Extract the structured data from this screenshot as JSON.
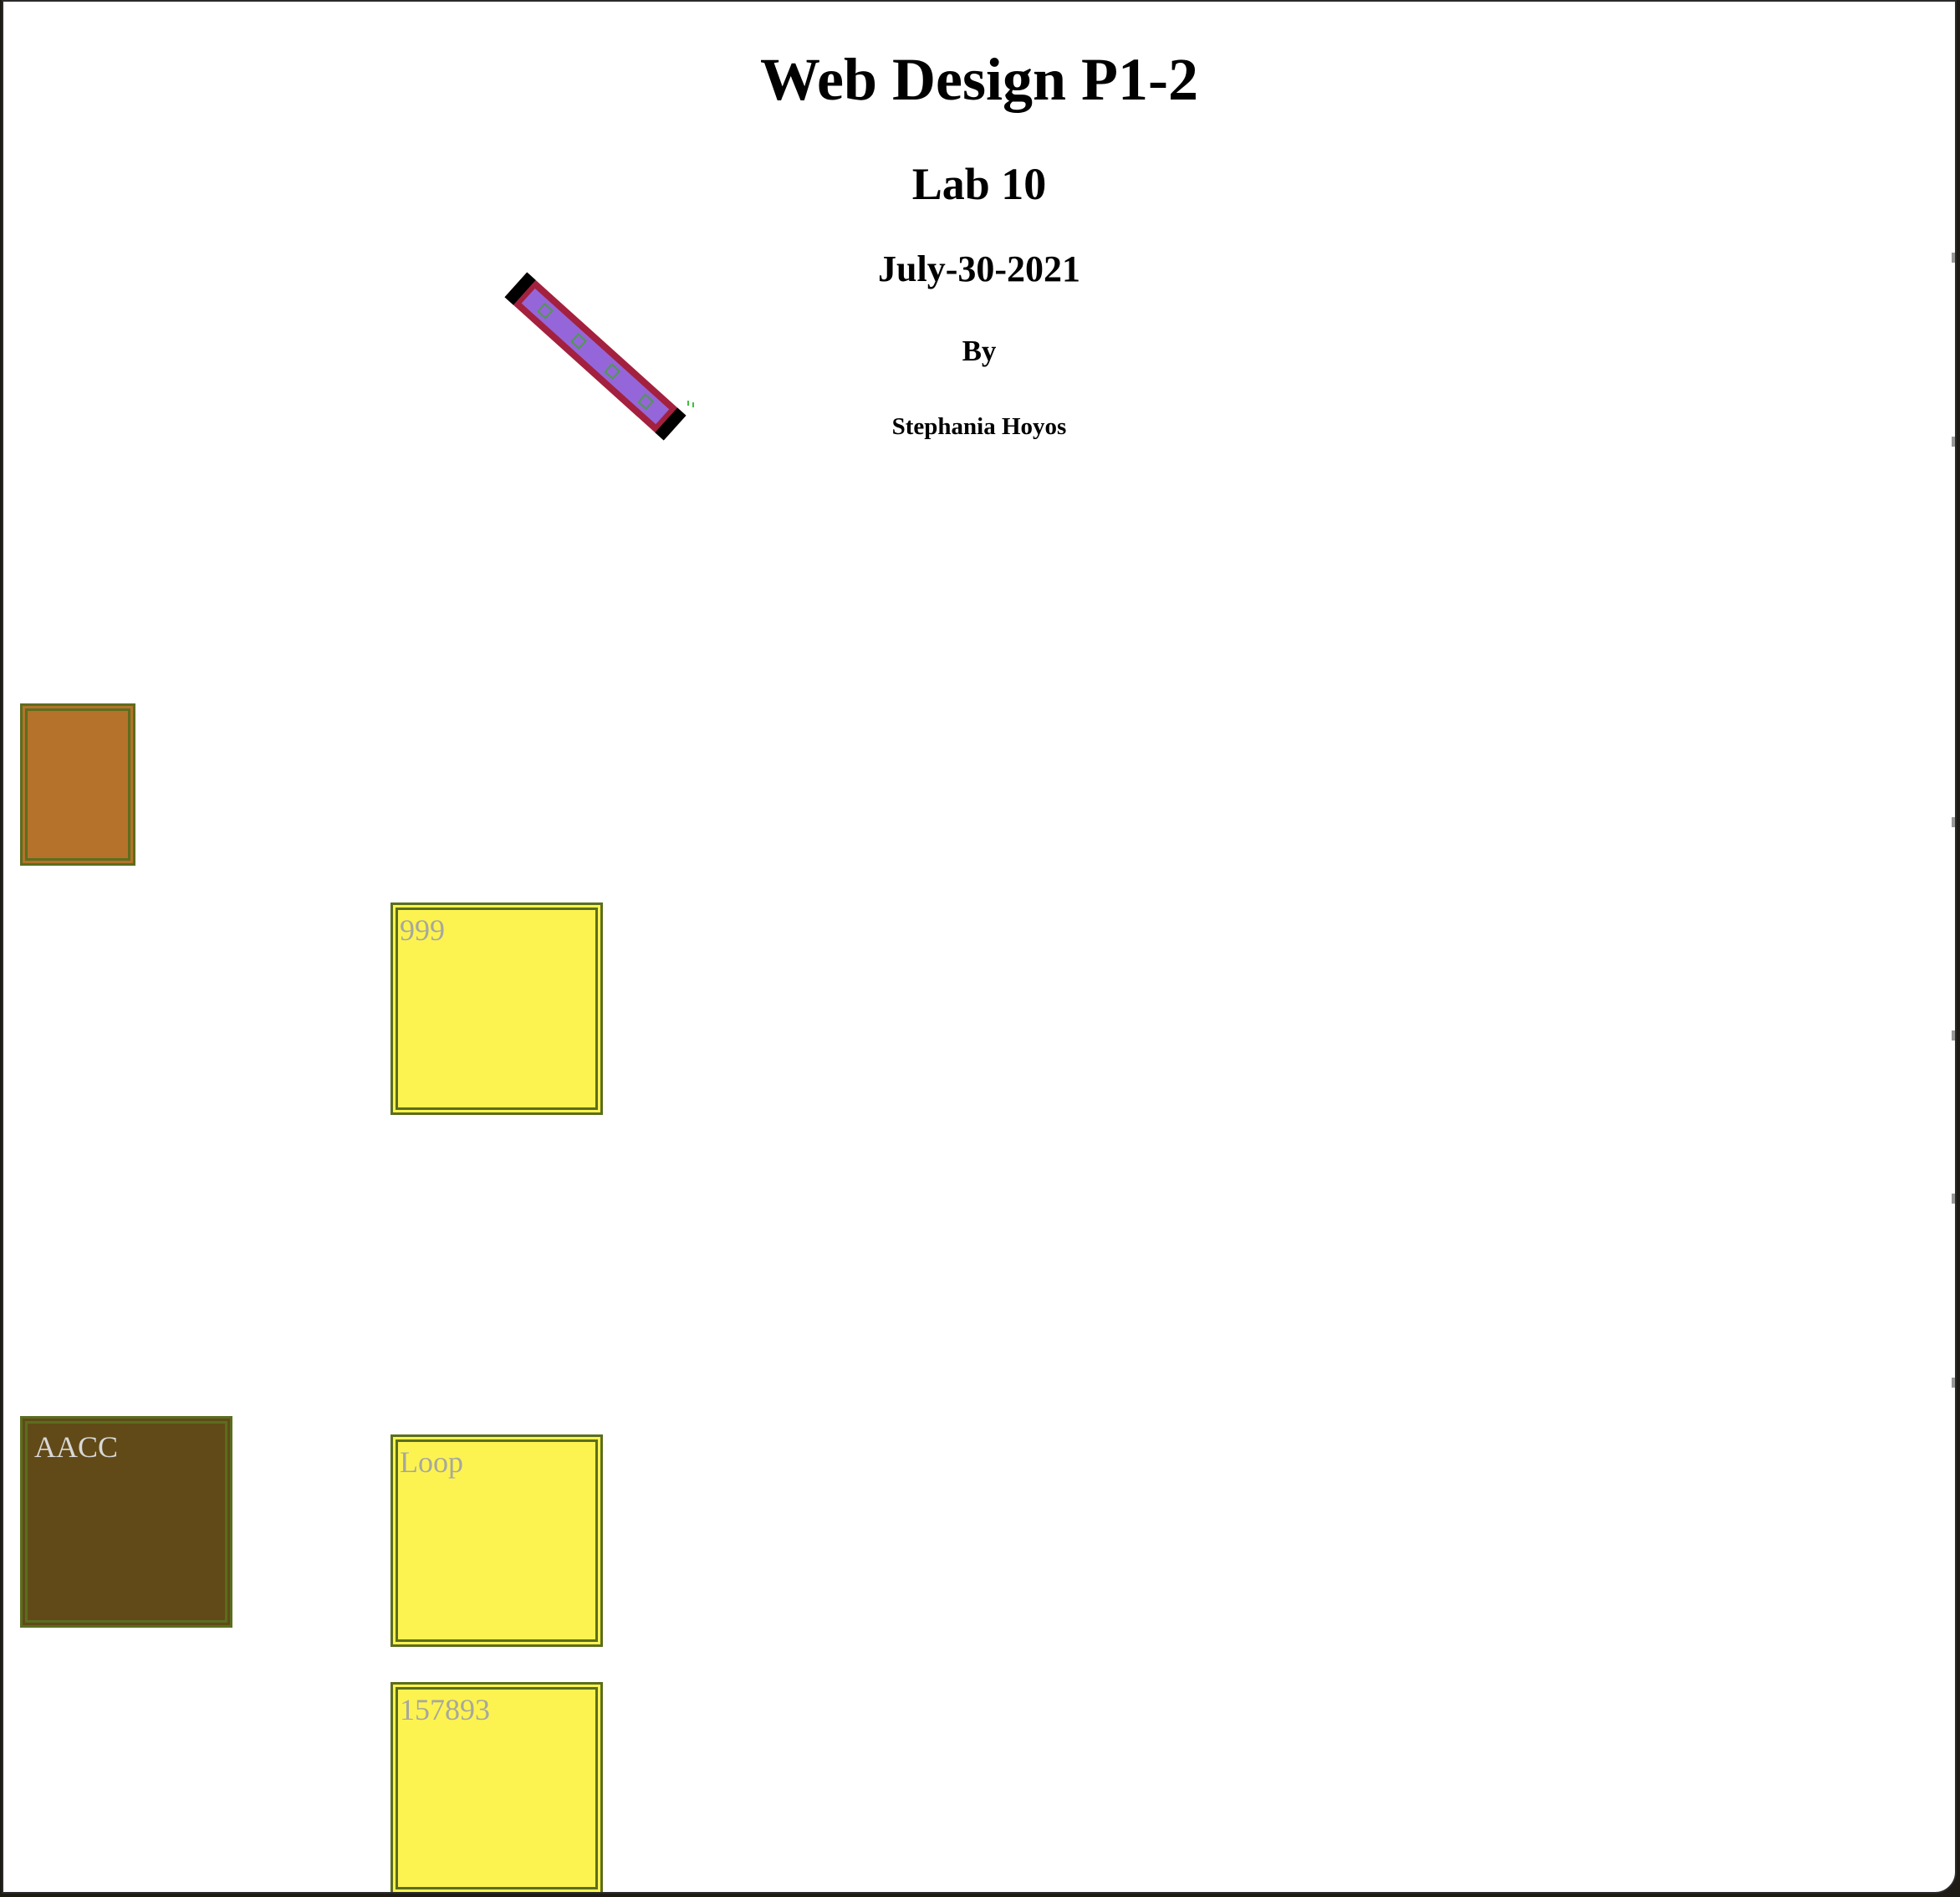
{
  "header": {
    "title": "Web Design P1-2",
    "lab": "Lab 10",
    "date": "July-30-2021",
    "by": "By",
    "author": "Stephania Hoyos"
  },
  "boxes": {
    "orange": {
      "text": ""
    },
    "brown": {
      "text": "AACC"
    },
    "yellow_1": {
      "text": "999"
    },
    "yellow_2": {
      "text": "Loop"
    },
    "yellow_3": {
      "text": "157893"
    }
  },
  "colors": {
    "orange_box": "#b5722a",
    "brown_box": "#614a17",
    "yellow_box": "#fdf350",
    "box_border": "#5b6e1f",
    "rotated_bar": "#a3213e",
    "rotated_inner": "#9566d9"
  }
}
